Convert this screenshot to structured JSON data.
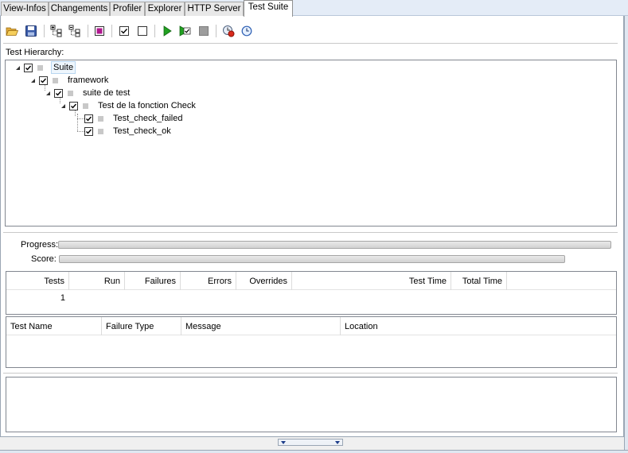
{
  "tabs": [
    {
      "label": "View-Infos"
    },
    {
      "label": "Changements"
    },
    {
      "label": "Profiler"
    },
    {
      "label": "Explorer"
    },
    {
      "label": "HTTP Server"
    },
    {
      "label": "Test Suite"
    }
  ],
  "active_tab": "Test Suite",
  "toolbar": {
    "icons": [
      "open-folder-icon",
      "save-icon",
      "expand-tree-icon",
      "collapse-tree-icon",
      "select-all-icon",
      "check-all-icon",
      "uncheck-all-icon",
      "run-icon",
      "run-checked-icon",
      "stop-icon",
      "reset-icon",
      "clock-icon"
    ]
  },
  "hierarchy": {
    "label": "Test Hierarchy:",
    "nodes": [
      {
        "label": "Suite",
        "checked": true
      },
      {
        "label": "framework",
        "checked": true
      },
      {
        "label": "suite de test",
        "checked": true
      },
      {
        "label": "Test de la fonction Check",
        "checked": true
      },
      {
        "label": "Test_check_failed",
        "checked": true
      },
      {
        "label": "Test_check_ok",
        "checked": true
      }
    ]
  },
  "progress": {
    "progress_label": "Progress:",
    "score_label": "Score:",
    "progress_value": 1.0,
    "score_value": 1.0
  },
  "stats": {
    "headers": [
      "Tests",
      "Run",
      "Failures",
      "Errors",
      "Overrides",
      "Test Time",
      "Total Time"
    ],
    "values": {
      "tests": "1"
    }
  },
  "failures": {
    "headers": [
      "Test Name",
      "Failure Type",
      "Message",
      "Location"
    ]
  },
  "colors": {
    "tab_bg": "#e4ecf7",
    "play_green": "#21a121",
    "select_magenta": "#b0198f"
  }
}
